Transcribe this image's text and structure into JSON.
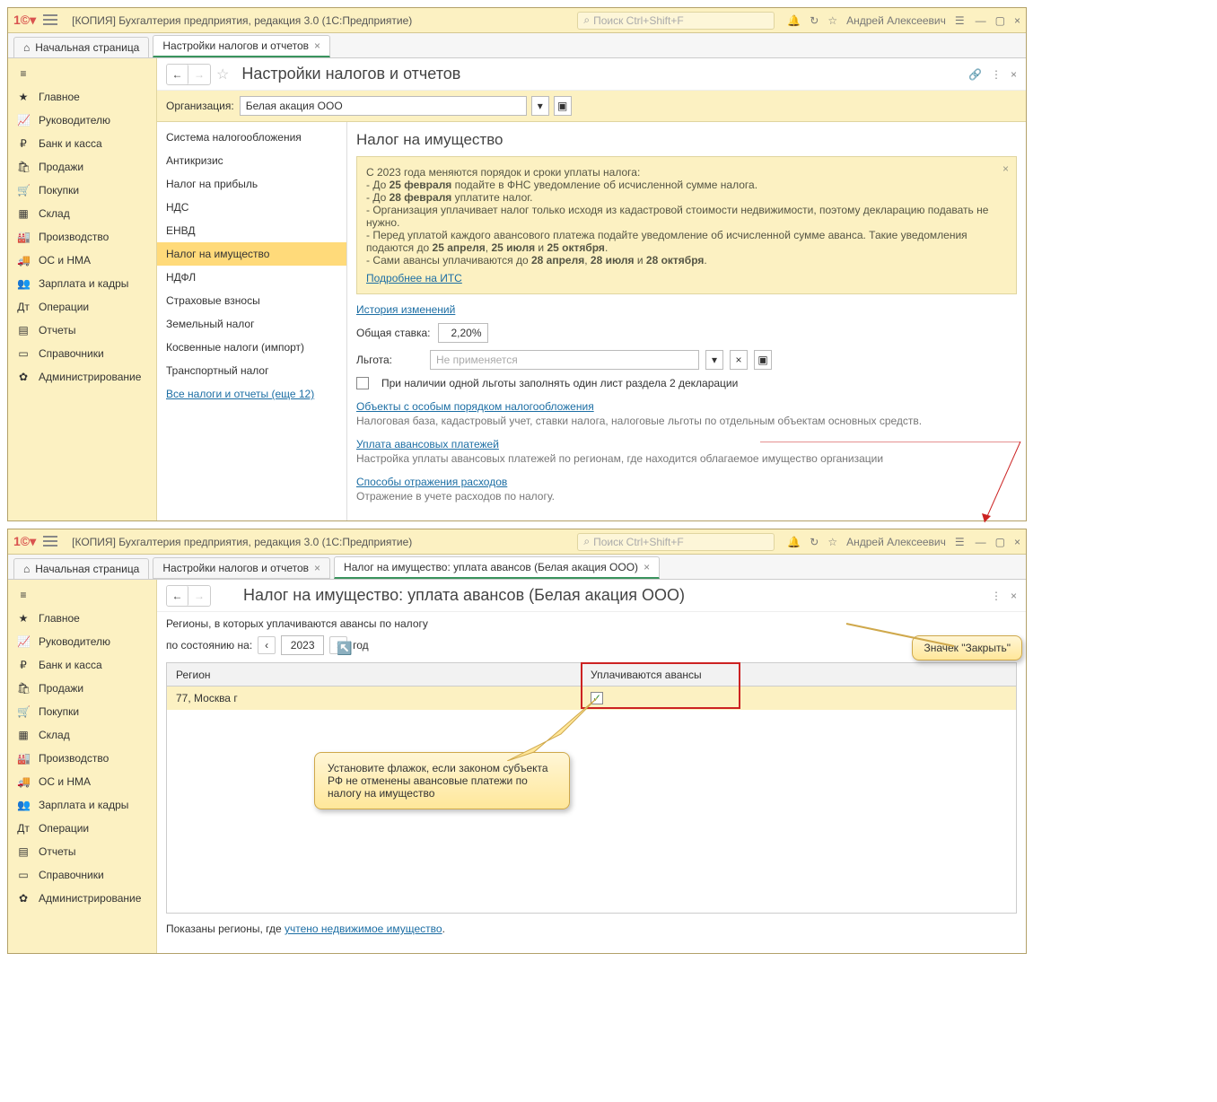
{
  "app": {
    "title": "[КОПИЯ] Бухгалтерия предприятия, редакция 3.0  (1С:Предприятие)",
    "search_placeholder": "Поиск Ctrl+Shift+F",
    "user": "Андрей Алексеевич"
  },
  "tabs": {
    "home": "Начальная страница",
    "settings": "Настройки налогов и отчетов",
    "avans": "Налог на имущество: уплата авансов (Белая акация ООО)"
  },
  "sidebar": {
    "items": [
      {
        "icon": "★",
        "label": "Главное"
      },
      {
        "icon": "📈",
        "label": "Руководителю"
      },
      {
        "icon": "₽",
        "label": "Банк и касса"
      },
      {
        "icon": "🛍",
        "label": "Продажи"
      },
      {
        "icon": "🛒",
        "label": "Покупки"
      },
      {
        "icon": "▦",
        "label": "Склад"
      },
      {
        "icon": "🏭",
        "label": "Производство"
      },
      {
        "icon": "🚚",
        "label": "ОС и НМА"
      },
      {
        "icon": "👥",
        "label": "Зарплата и кадры"
      },
      {
        "icon": "Дт",
        "label": "Операции"
      },
      {
        "icon": "▤",
        "label": "Отчеты"
      },
      {
        "icon": "▭",
        "label": "Справочники"
      },
      {
        "icon": "✿",
        "label": "Администрирование"
      }
    ],
    "burger": "≡"
  },
  "page1": {
    "title": "Настройки налогов и отчетов",
    "org_label": "Организация:",
    "org_value": "Белая акация ООО",
    "tax_list": [
      "Система налогообложения",
      "Антикризис",
      "Налог на прибыль",
      "НДС",
      "ЕНВД",
      "Налог на имущество",
      "НДФЛ",
      "Страховые взносы",
      "Земельный налог",
      "Косвенные налоги (импорт)",
      "Транспортный налог"
    ],
    "tax_active_index": 5,
    "all_taxes_link": "Все налоги и отчеты (еще 12)",
    "detail_heading": "Налог на имущество",
    "info_lines": [
      "С 2023 года меняются порядок и сроки уплаты налога:",
      " - До 25 февраля подайте в ФНС уведомление об исчисленной сумме налога.",
      " - До 28 февраля уплатите налог.",
      " - Организация уплачивает налог только исходя из кадастровой стоимости недвижимости, поэтому декларацию подавать не нужно.",
      " - Перед уплатой каждого авансового платежа подайте уведомление об исчисленной сумме аванса. Такие уведомления подаются до 25 апреля, 25 июля и 25 октября.",
      " - Сами авансы уплачиваются до 28 апреля, 28 июля и 28 октября."
    ],
    "more_link": "Подробнее на ИТС",
    "history_link": "История изменений",
    "rate_label": "Общая ставка:",
    "rate_value": "2,20%",
    "benefit_label": "Льгота:",
    "benefit_placeholder": "Не применяется",
    "check_label": "При наличии одной льготы заполнять один лист раздела 2 декларации",
    "link_objects": "Объекты с особым порядком налогообложения",
    "desc_objects": "Налоговая база, кадастровый учет, ставки налога, налоговые льготы по отдельным объектам основных средств.",
    "link_avans": "Уплата авансовых платежей",
    "desc_avans": "Настройка уплаты авансовых платежей по регионам, где находится облагаемое имущество организации",
    "link_expense": "Способы отражения расходов",
    "desc_expense": "Отражение в учете расходов по налогу."
  },
  "page2": {
    "title": "Налог на имущество: уплата авансов (Белая акация ООО)",
    "subtitle": "Регионы, в которых уплачиваются авансы по налогу",
    "asof_label": "по состоянию на:",
    "year": "2023",
    "year_suffix": "год",
    "col_region": "Регион",
    "col_avans": "Уплачиваются авансы",
    "row_region": "77, Москва г",
    "footer_prefix": "Показаны регионы, где ",
    "footer_link": "учтено недвижимое имущество",
    "callout_close": "Значек \"Закрыть\"",
    "callout_check": "Установите флажок, если законом субъекта РФ не отменены авансовые платежи по налогу на имущество"
  }
}
